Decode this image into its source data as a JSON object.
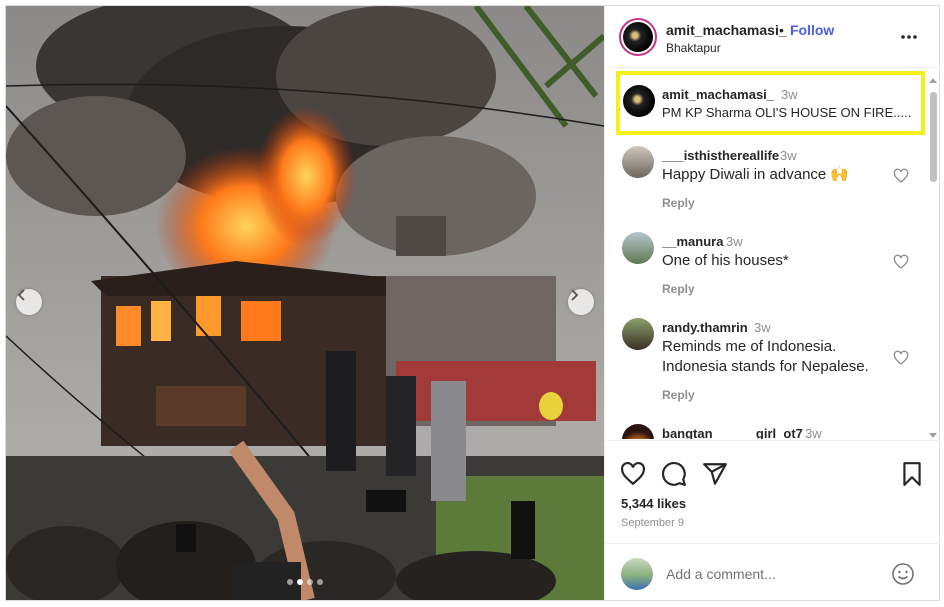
{
  "post": {
    "username": "amit_machamasi_",
    "separator": "•",
    "follow_label": "Follow",
    "location": "Bhaktapur",
    "more_icon": "more-horizontal-icon",
    "caption": {
      "username": "amit_machamasi_",
      "time": "3w",
      "text": "PM KP Sharma OLI'S HOUSE ON FIRE....."
    },
    "highlight_color": "#f5ef1a",
    "follow_color": "#4a5de8"
  },
  "comments": [
    {
      "username": "___isthisthereallife",
      "time": "3w",
      "text": "Happy Diwali in advance 🙌",
      "reply": "Reply"
    },
    {
      "username": "__manura",
      "time": "3w",
      "text": "One of his houses*",
      "reply": "Reply"
    },
    {
      "username": "randy.thamrin",
      "time": "3w",
      "text_line1": "Reminds me of Indonesia.",
      "text_line2": "Indonesia stands for Nepalese.",
      "reply": "Reply"
    },
    {
      "username": "bangtan______girl_ot7",
      "time": "3w"
    }
  ],
  "actions": {
    "icons": [
      "heart-icon",
      "comment-icon",
      "share-icon",
      "bookmark-icon"
    ],
    "likes": "5,344 likes",
    "date": "September 9",
    "add_comment_placeholder": "Add a comment...",
    "emoji_icon": "emoji-icon"
  },
  "carousel": {
    "total_slides": 4,
    "active_index": 1,
    "prev_icon": "chevron-left-icon",
    "next_icon": "chevron-right-icon"
  }
}
